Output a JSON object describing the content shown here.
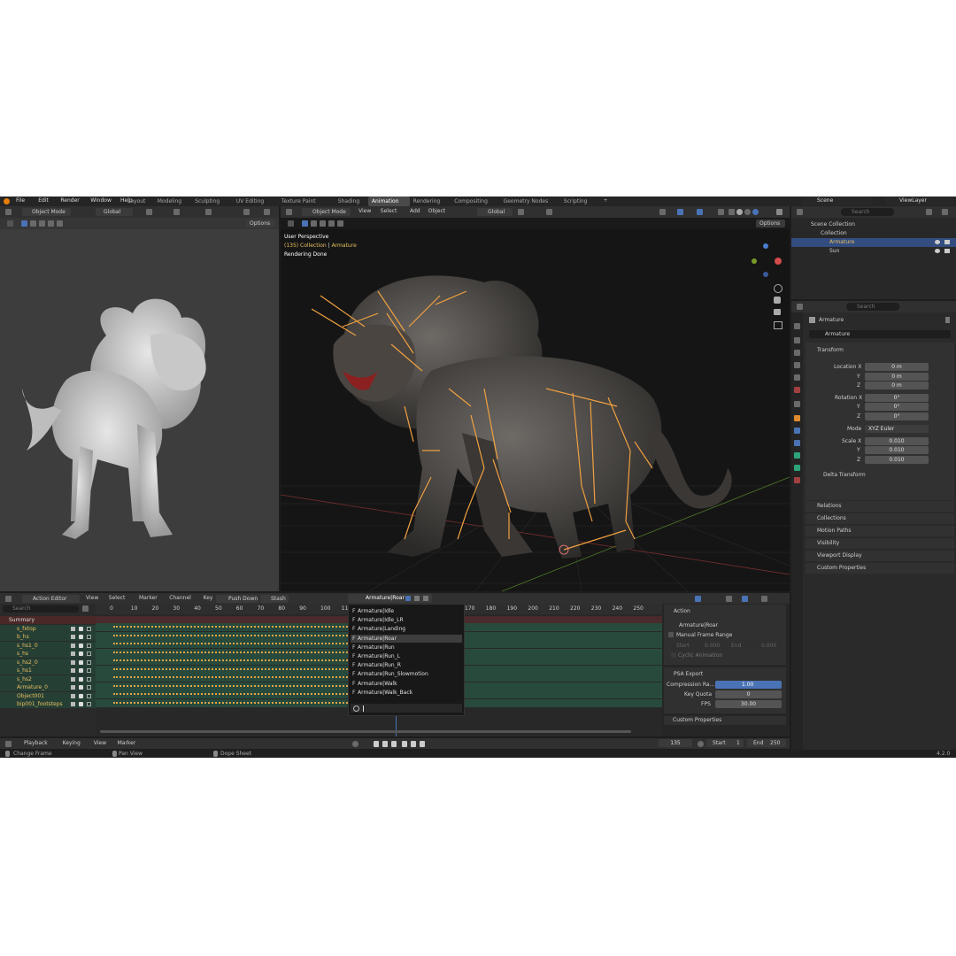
{
  "topbar": {
    "menus": [
      "File",
      "Edit",
      "Render",
      "Window",
      "Help"
    ],
    "workspaces": [
      "Layout",
      "Modeling",
      "Sculpting",
      "UV Editing",
      "Texture Paint",
      "Shading",
      "Animation",
      "Rendering",
      "Compositing",
      "Geometry Nodes",
      "Scripting"
    ],
    "active_workspace": "Animation",
    "add_tab": "+",
    "scene_label": "Scene",
    "viewlayer_label": "ViewLayer"
  },
  "left_view": {
    "mode": "Object Mode",
    "orientation": "Global",
    "options": "Options"
  },
  "main_view": {
    "mode": "Object Mode",
    "menus": [
      "View",
      "Select",
      "Add",
      "Object"
    ],
    "orientation": "Global",
    "options": "Options",
    "info_line1": "User Perspective",
    "info_frame": "(135) Collection",
    "info_sep": "|",
    "info_object": "Armature",
    "info_line3": "Rendering Done"
  },
  "outliner": {
    "search_placeholder": "Search",
    "root": "Scene Collection",
    "collection": "Collection",
    "items": [
      {
        "name": "Armature",
        "selected": true
      },
      {
        "name": "Sun",
        "selected": false
      }
    ]
  },
  "properties": {
    "search_placeholder": "Search",
    "object_name": "Armature",
    "data_name": "Armature",
    "transform_title": "Transform",
    "location": {
      "label": "Location X",
      "y_label": "Y",
      "z_label": "Z",
      "x": "0 m",
      "y": "0 m",
      "z": "0 m"
    },
    "rotation": {
      "label": "Rotation X",
      "y_label": "Y",
      "z_label": "Z",
      "x": "0°",
      "y": "0°",
      "z": "0°"
    },
    "mode_label": "Mode",
    "mode_value": "XYZ Euler",
    "scale": {
      "label": "Scale X",
      "y_label": "Y",
      "z_label": "Z",
      "x": "0.010",
      "y": "0.010",
      "z": "0.010"
    },
    "delta_transform": "Delta Transform",
    "panels": [
      "Relations",
      "Collections",
      "Motion Paths",
      "Visibility",
      "Viewport Display",
      "Custom Properties"
    ]
  },
  "action_editor": {
    "editor_mode": "Action Editor",
    "menus": [
      "View",
      "Select",
      "Marker",
      "Channel",
      "Key"
    ],
    "push_down": "Push Down",
    "stash": "Stash",
    "action_name": "Armature|Roar",
    "search_placeholder": "Search",
    "channels": [
      "Summary",
      "s_fxtop",
      "b_hs",
      "s_hs1_0",
      "s_hs",
      "s_hs2_0",
      "s_hs1",
      "s_hs2",
      "Armature_0",
      "Object001",
      "bip001_footsteps"
    ],
    "ruler_left": [
      "0",
      "10",
      "20",
      "30",
      "40",
      "50",
      "60",
      "70",
      "80",
      "90",
      "100",
      "110"
    ],
    "ruler_right": [
      "170",
      "180",
      "190",
      "200",
      "210",
      "220",
      "230",
      "240",
      "250"
    ]
  },
  "action_dropdown": {
    "prefix": "F",
    "items": [
      "Armature|Idle",
      "Armature|Idle_LR",
      "Armature|Landing",
      "Armature|Roar",
      "Armature|Run",
      "Armature|Run_L",
      "Armature|Run_R",
      "Armature|Run_Slowmotion",
      "Armature|Walk",
      "Armature|Walk_Back"
    ],
    "selected": "Armature|Roar"
  },
  "sidebar": {
    "action_title": "Action",
    "action_name": "Armature|Roar",
    "manual_frame_range": "Manual Frame Range",
    "start_label": "Start",
    "start_value": "0.000",
    "end_label": "End",
    "end_value": "0.000",
    "cyclic": "Cyclic Animation",
    "psa_title": "PSA Export",
    "compression_label": "Compression Ra...",
    "compression_value": "1.00",
    "compression_fill": 1.0,
    "key_quota_label": "Key Quota",
    "key_quota_value": "0",
    "fps_label": "FPS",
    "fps_value": "30.00",
    "custom_props": "Custom Properties"
  },
  "timeline": {
    "menus": [
      "Playback",
      "Keying",
      "View",
      "Marker"
    ],
    "current_frame": "135",
    "start_label": "Start",
    "start_value": "1",
    "end_label": "End",
    "end_value": "250"
  },
  "status": {
    "change_frame": "Change Frame",
    "pan_view": "Pan View",
    "dope_sheet": "Dope Sheet",
    "version": "4.2.0"
  },
  "colors": {
    "accent": "#4a73b5",
    "bone": "#f0a040",
    "selected_text": "#e8c060",
    "header": "#303030"
  }
}
